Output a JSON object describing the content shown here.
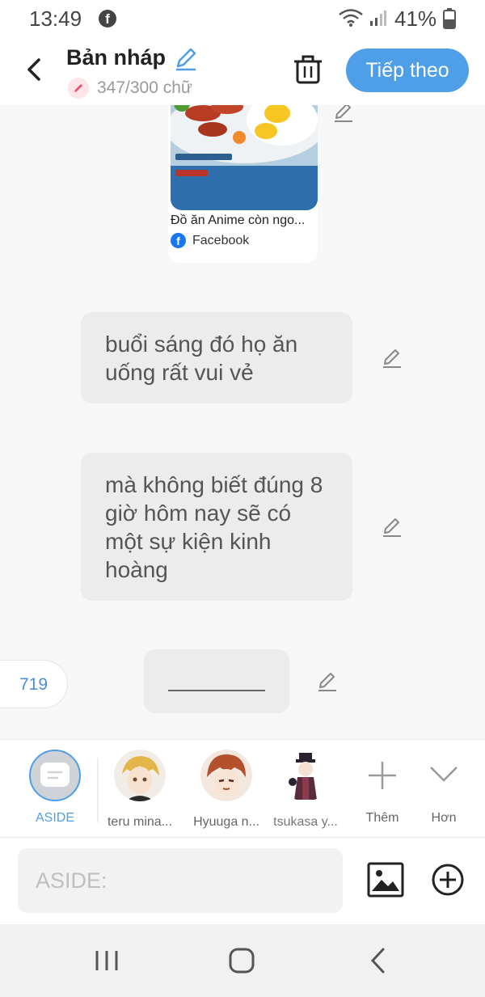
{
  "status_bar": {
    "time": "13:49",
    "battery": "41%",
    "icons": [
      "facebook-icon",
      "wifi-icon",
      "signal-icon",
      "battery-icon"
    ]
  },
  "header": {
    "title": "Bản nháp",
    "word_count": "347/300 chữ",
    "next_label": "Tiếp theo",
    "icons": [
      "back-icon",
      "pencil-icon",
      "trash-icon"
    ],
    "accent_color": "#4f9fe8"
  },
  "link_card": {
    "title": "Đồ ăn Anime còn ngo...",
    "source": "Facebook"
  },
  "messages": [
    {
      "text": "buổi sáng đó họ ăn uống rất vui vẻ"
    },
    {
      "text": "mà không biết đúng 8 giờ hôm nay sẽ có một sự kiện kinh hoàng"
    }
  ],
  "counter": "719",
  "characters": [
    {
      "label": "ASIDE",
      "selected": true
    },
    {
      "label": "teru mina..."
    },
    {
      "label": "Hyuuga n..."
    },
    {
      "label": "tsukasa y..."
    }
  ],
  "actions": {
    "more_label": "Thêm",
    "less_label": "Hơn"
  },
  "input": {
    "placeholder": "ASIDE:",
    "value": ""
  }
}
